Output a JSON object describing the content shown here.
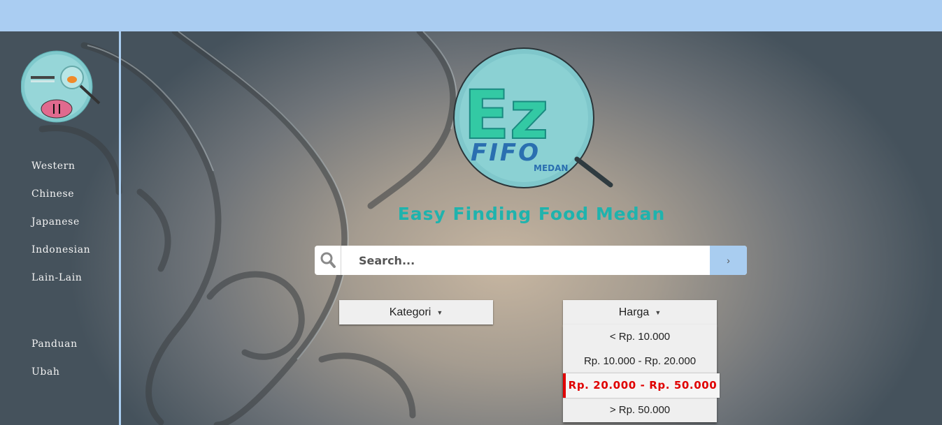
{
  "sidebar": {
    "nav_primary": [
      "Western",
      "Chinese",
      "Japanese",
      "Indonesian",
      "Lain-Lain"
    ],
    "nav_secondary": [
      "Panduan",
      "Ubah"
    ]
  },
  "logo": {
    "big_letters": "Ez",
    "word": "FIFO",
    "city": "MEDAN"
  },
  "tagline": "Easy Finding Food Medan",
  "search": {
    "placeholder": "Search...",
    "submit_glyph": "›"
  },
  "filters": {
    "kategori_label": "Kategori",
    "harga_label": "Harga",
    "harga_options": [
      "< Rp. 10.000",
      "Rp. 10.000 - Rp. 20.000",
      "Rp. 20.000 - Rp. 50.000",
      "> Rp. 50.000"
    ],
    "harga_selected_index": 2
  },
  "colors": {
    "topbar": "#aacdf2",
    "accent_teal": "#1fb3ad",
    "selected_red": "#e00000"
  },
  "icons": [
    "search-icon",
    "chevron-right-icon",
    "caret-down-icon",
    "fork-knife-icon",
    "magnifier-icon"
  ]
}
